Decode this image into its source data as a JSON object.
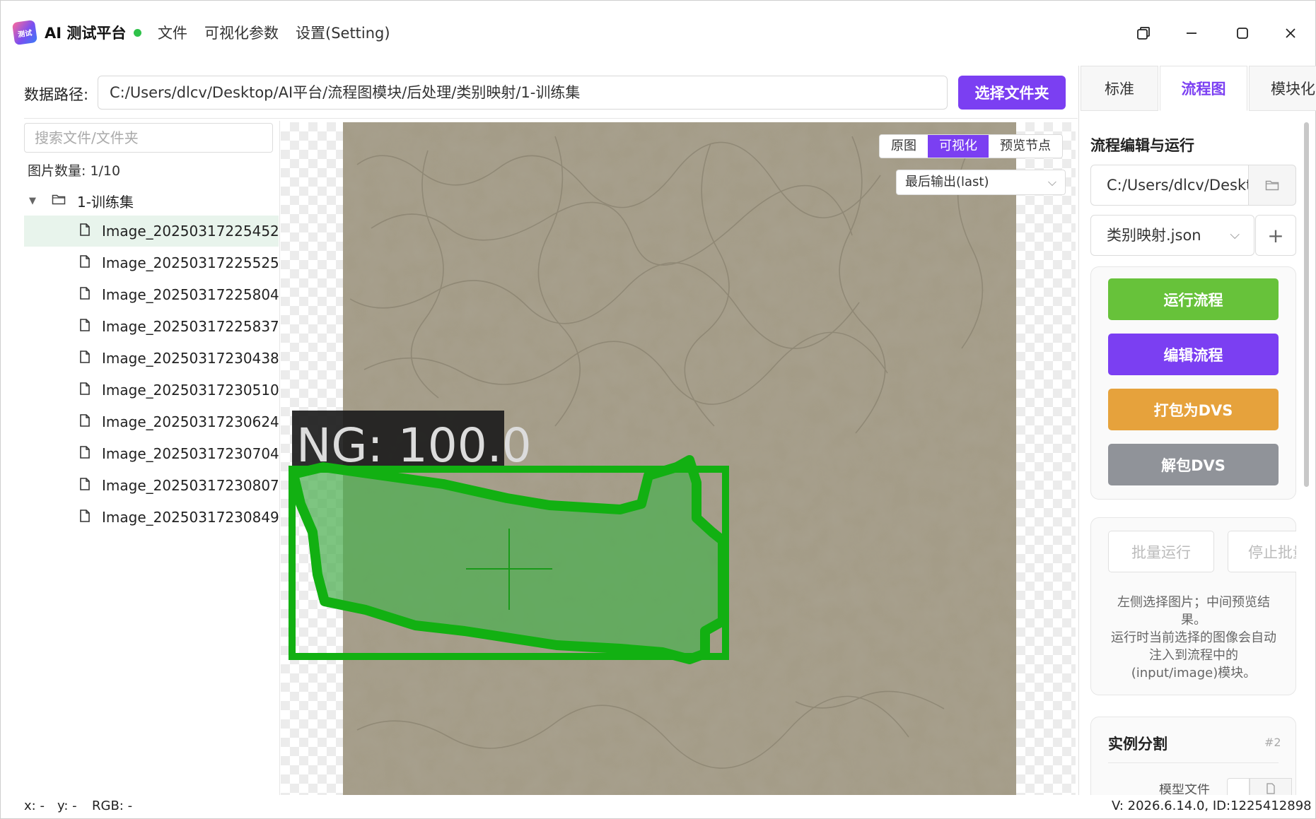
{
  "titlebar": {
    "logo_text": "测试",
    "app_title": "AI 测试平台",
    "menu": [
      "文件",
      "可视化参数",
      "设置(Setting)"
    ]
  },
  "path_row": {
    "label": "数据路径:",
    "value": "C:/Users/dlcv/Desktop/AI平台/流程图模块/后处理/类别映射/1-训练集",
    "choose_button": "选择文件夹"
  },
  "left_panel": {
    "search_placeholder": "搜索文件/文件夹",
    "image_count": "图片数量: 1/10",
    "folder": "1-训练集",
    "files": [
      "Image_20250317225452",
      "Image_20250317225525",
      "Image_20250317225804",
      "Image_20250317225837",
      "Image_20250317230438",
      "Image_20250317230510",
      "Image_20250317230624",
      "Image_20250317230704",
      "Image_20250317230807",
      "Image_20250317230849"
    ],
    "selected_index": 0
  },
  "viewer": {
    "tabs": [
      "原图",
      "可视化",
      "预览节点"
    ],
    "active_tab": "可视化",
    "output_select": "最后输出(last)",
    "annotation_label": "NG: 100.0",
    "annotation_color": "#12b012",
    "mask_color": "#4caf50"
  },
  "right_panel": {
    "tabs": [
      "标准",
      "流程图",
      "模块化"
    ],
    "active_tab": "流程图",
    "section_title": "流程编辑与运行",
    "flow_path": "C:/Users/dlcv/Desktop",
    "flow_file": "类别映射.json",
    "buttons": {
      "run": "运行流程",
      "edit": "编辑流程",
      "pack": "打包为DVS",
      "unpack": "解包DVS",
      "batch_run": "批量运行",
      "stop_batch": "停止批量"
    },
    "button_colors": {
      "run": "#67c23a",
      "edit": "#7b3ff2",
      "pack": "#e6a23c",
      "unpack": "#909399"
    },
    "hint_lines": [
      "左侧选择图片；中间预览结",
      "果。",
      "运行时当前选择的图像会自动",
      "注入到流程中的",
      "(input/image)模块。"
    ],
    "module": {
      "title": "实例分割",
      "index": "#2",
      "field_label": "模型文件"
    }
  },
  "statusbar": {
    "x": "x: -",
    "y": "y: -",
    "rgb": "RGB: -",
    "version": "V: 2026.6.14.0, ID:1225412898"
  }
}
